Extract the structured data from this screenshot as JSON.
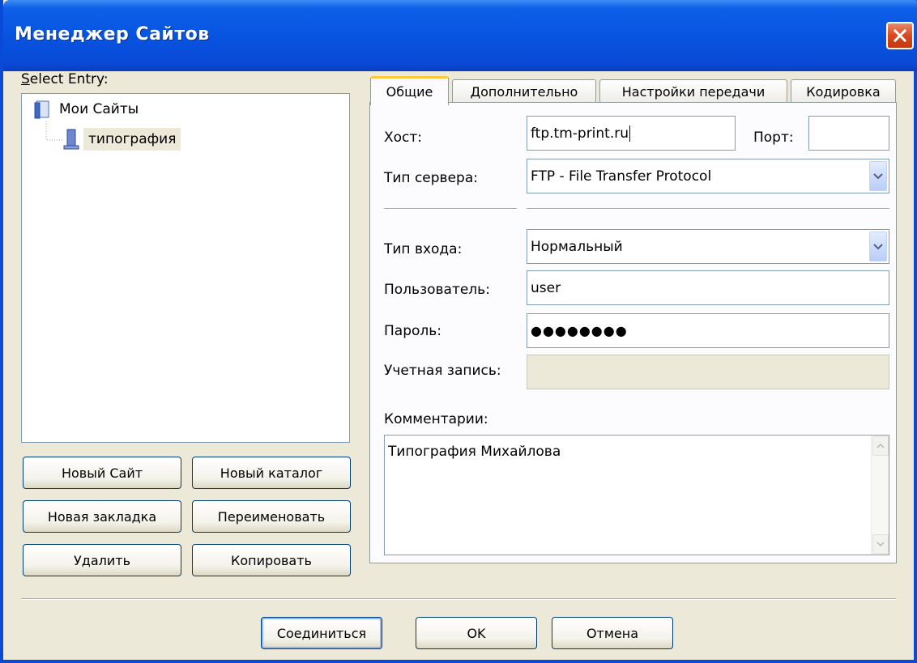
{
  "window": {
    "title": "Менеджер Сайтов",
    "close_icon": "close-icon"
  },
  "left": {
    "select_entry_label": "Select Entry:",
    "tree": {
      "root": {
        "label": "Мои Сайты",
        "icon": "folder-icon"
      },
      "child": {
        "label": "типография",
        "icon": "server-icon",
        "selected": true
      }
    },
    "buttons": {
      "new_site": "Новый Сайт",
      "new_folder": "Новый каталог",
      "new_bookmark": "Новая закладка",
      "rename": "Переименовать",
      "delete": "Удалить",
      "copy": "Копировать"
    }
  },
  "tabs": [
    "Общие",
    "Дополнительно",
    "Настройки передачи",
    "Кодировка"
  ],
  "general": {
    "host_label": "Хост:",
    "host_value": "ftp.tm-print.ru",
    "port_label": "Порт:",
    "port_value": "",
    "server_type_label": "Тип сервера:",
    "server_type_value": "FTP - File Transfer Protocol",
    "logon_type_label": "Тип входа:",
    "logon_type_value": "Нормальный",
    "user_label": "Пользователь:",
    "user_value": "user",
    "password_label": "Пароль:",
    "password_value": "●●●●●●●●",
    "account_label": "Учетная запись:",
    "account_value": "",
    "comments_label": "Комментарии:",
    "comments_value": "Типография Михайлова"
  },
  "footer": {
    "connect": "Соединиться",
    "ok": "OK",
    "cancel": "Отмена"
  },
  "colors": {
    "titlebar": "#0a4ad8",
    "face": "#ece9d8",
    "close": "#d9481f",
    "tab_accent": "#ffc83c"
  }
}
